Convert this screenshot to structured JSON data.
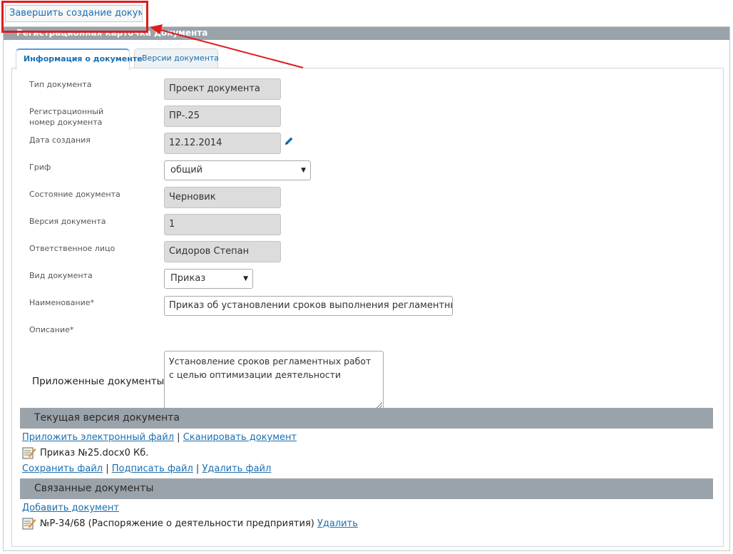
{
  "toolbar": {
    "finish_label": "Завершить создание документа"
  },
  "card": {
    "title": "Регистрационная карточка документа"
  },
  "tabs": [
    {
      "label": "Информация о документе",
      "active": true
    },
    {
      "label": "Версии документа",
      "active": false
    }
  ],
  "fields": {
    "doc_type": {
      "label": "Тип документа",
      "value": "Проект документа"
    },
    "reg_number": {
      "label": "Регистрационный номер документа",
      "value": "ПР-.25"
    },
    "created_date": {
      "label": "Дата создания",
      "value": "12.12.2014"
    },
    "grif": {
      "label": "Гриф",
      "value": "общий"
    },
    "status": {
      "label": "Состояние документа",
      "value": "Черновик"
    },
    "version": {
      "label": "Версия документа",
      "value": "1"
    },
    "responsible": {
      "label": "Ответственное лицо",
      "value": "Сидоров Степан"
    },
    "doc_kind": {
      "label": "Вид документа",
      "value": "Приказ"
    },
    "name": {
      "label": "Наименование*",
      "value": "Приказ об установлении сроков выполнения регламентных работ"
    },
    "description": {
      "label": "Описание*",
      "value": "Установление сроков регламентных работ с целью оптимизации деятельности"
    }
  },
  "attached": {
    "title": "Приложенные документы",
    "current_version": {
      "header": "Текущая версия документа",
      "attach_link": "Приложить электронный файл",
      "scan_link": "Сканировать документ",
      "file_name": "Приказ №25.docx0 Кб.",
      "save_link": "Сохранить файл",
      "sign_link": "Подписать файл",
      "delete_link": "Удалить файл"
    },
    "related": {
      "header": "Связанные документы",
      "add_link": "Добавить документ",
      "item_text": "№Р-34/68 (Распоряжение о деятельности предприятия)",
      "item_delete": "Удалить"
    }
  },
  "colors": {
    "highlight": "#e01b1b",
    "link": "#1a6fb0",
    "section_bar": "#9ba3aa"
  },
  "icons": {
    "edit": "pencil-icon",
    "file": "document-note-icon",
    "dropdown": "caret-down-icon"
  }
}
